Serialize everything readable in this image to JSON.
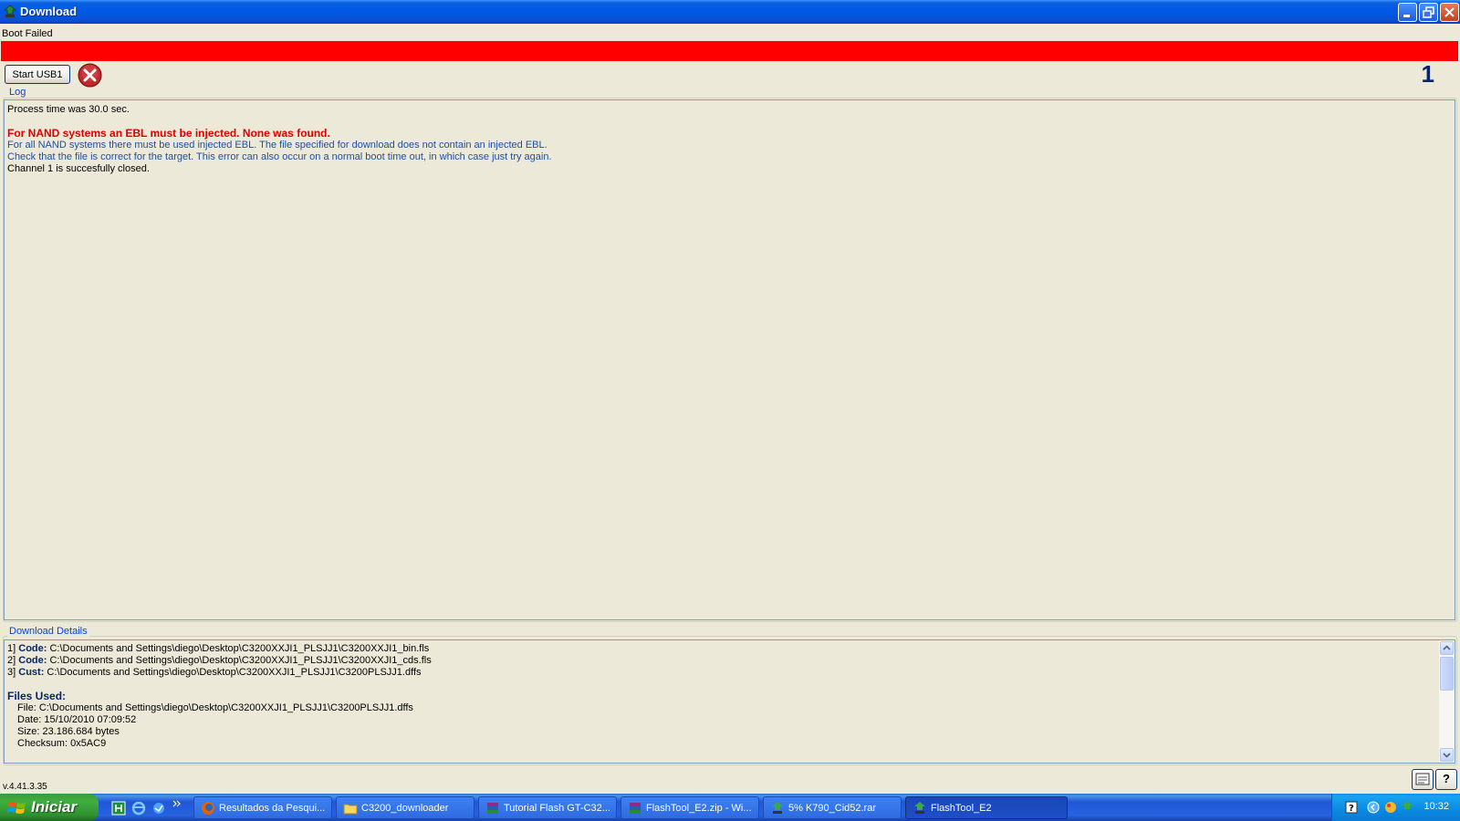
{
  "window": {
    "title": "Download"
  },
  "status": {
    "label": "Boot Failed",
    "bar_color": "#FF0000",
    "start_button": "Start USB1",
    "channel_number": "1"
  },
  "log": {
    "legend": "Log",
    "lines": [
      "Process time was 30.0 sec.",
      "For NAND systems an EBL must be injected. None was found.",
      "For all NAND systems there must be used injected EBL. The file specified for download does not contain an injected EBL.",
      "Check that the file is correct for the target. This error can also occur on a normal boot time out, in which case just try again.",
      "Channel 1 is succesfully closed."
    ]
  },
  "details": {
    "legend": "Download Details",
    "entries": [
      {
        "num": "1]",
        "label": "Code:",
        "path": "C:\\Documents and Settings\\diego\\Desktop\\C3200XXJI1_PLSJJ1\\C3200XXJI1_bin.fls"
      },
      {
        "num": "2]",
        "label": "Code:",
        "path": "C:\\Documents and Settings\\diego\\Desktop\\C3200XXJI1_PLSJJ1\\C3200XXJI1_cds.fls"
      },
      {
        "num": "3]",
        "label": "Cust:",
        "path": "C:\\Documents and Settings\\diego\\Desktop\\C3200XXJI1_PLSJJ1\\C3200PLSJJ1.dffs"
      }
    ],
    "files_used_heading": "Files Used:",
    "file_line": "File: C:\\Documents and Settings\\diego\\Desktop\\C3200XXJI1_PLSJJ1\\C3200PLSJJ1.dffs",
    "date_line": "Date: 15/10/2010 07:09:52",
    "size_line": "Size: 23.186.684 bytes",
    "checksum_line": "Checksum: 0x5AC9"
  },
  "footer": {
    "version": "v.4.41.3.35",
    "help_label": "?"
  },
  "taskbar": {
    "start_label": "Iniciar",
    "items": [
      "Resultados da Pesqui...",
      "C3200_downloader",
      "Tutorial Flash GT-C32...",
      "FlashTool_E2.zip - Wi...",
      "5% K790_Cid52.rar",
      "FlashTool_E2"
    ],
    "clock": "10:32"
  }
}
